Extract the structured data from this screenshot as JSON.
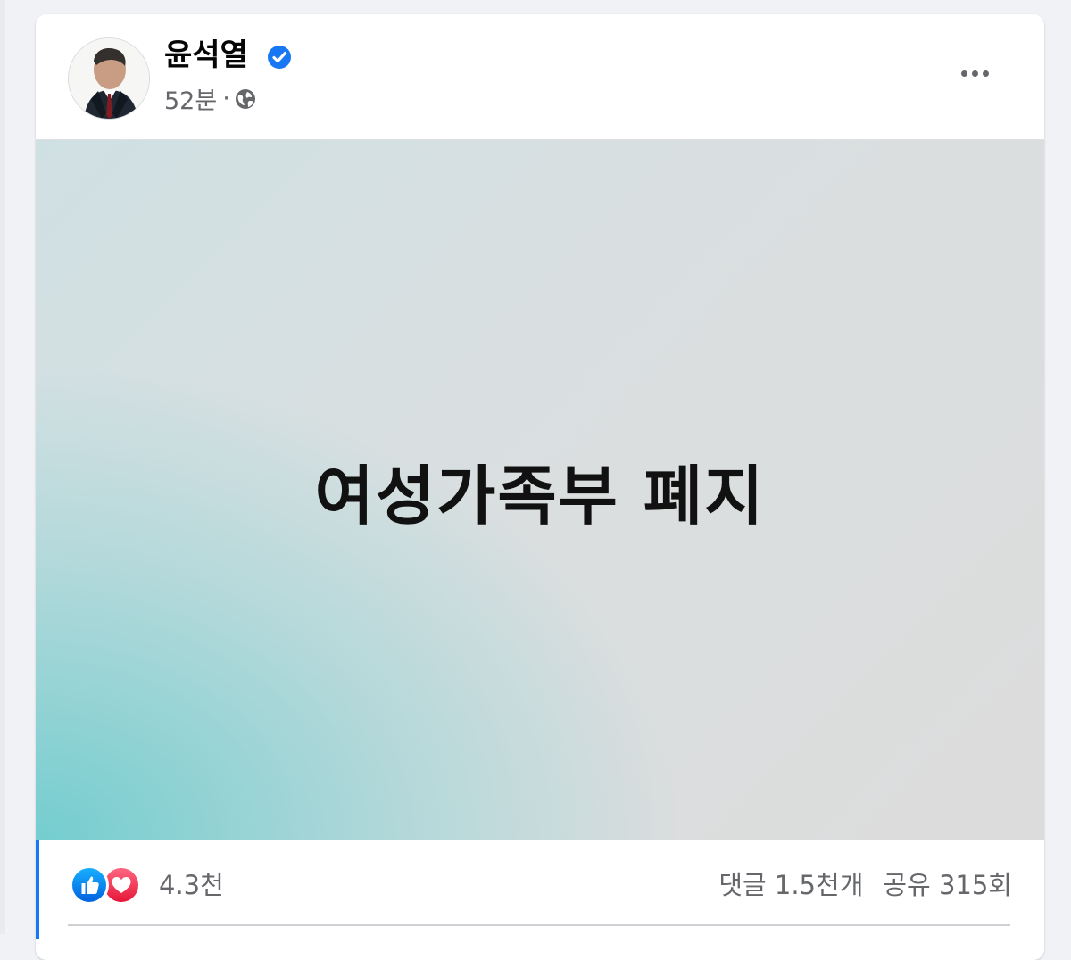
{
  "post": {
    "author": "윤석열",
    "time": "52분",
    "separator": "·",
    "text": "여성가족부 폐지",
    "reactions": {
      "count": "4.3천",
      "types": [
        "like-icon",
        "love-icon"
      ]
    },
    "comments": "댓글 1.5천개",
    "shares": "공유 315회"
  },
  "colors": {
    "page_background": "#f0f2f5",
    "facebook_blue": "#1877f2",
    "meta_text": "#65676b",
    "gradient_teal": "#6eccce",
    "gradient_gray": "#dcdcdc"
  },
  "icons": {
    "verified": "verified-badge-icon",
    "audience": "globe-icon",
    "menu": "more-options-icon"
  }
}
